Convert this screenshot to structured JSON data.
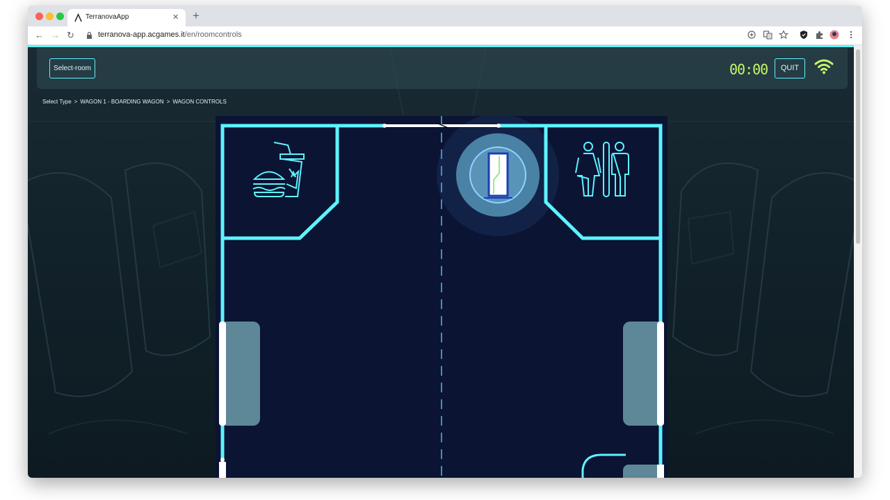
{
  "browser": {
    "tab_title": "TerranovaApp",
    "tab_close": "×",
    "new_tab": "+",
    "url_domain": "terranova-app.acgames.it",
    "url_path": "/en/roomcontrols",
    "nav_back": "←",
    "nav_forward": "→",
    "nav_reload": "↻"
  },
  "header": {
    "select_room_label": "Select-room",
    "timer": "00:00",
    "quit_label": "QUIT"
  },
  "breadcrumb": {
    "items": [
      "Select Type",
      "WAGON 1 - BOARDING WAGON",
      "WAGON CONTROLS"
    ],
    "separator": ">"
  },
  "floorplan": {
    "rooms": [
      "food-court-icon",
      "door-control-button",
      "restroom-icon"
    ],
    "accent_color": "#5ef3ff",
    "floor_color": "#0b1433",
    "seat_color": "#5e8797",
    "door_ring_color": "#3b7ea8"
  },
  "colors": {
    "accent": "#5ef3ff",
    "timer": "#c6f76a",
    "background": "#15252d"
  }
}
